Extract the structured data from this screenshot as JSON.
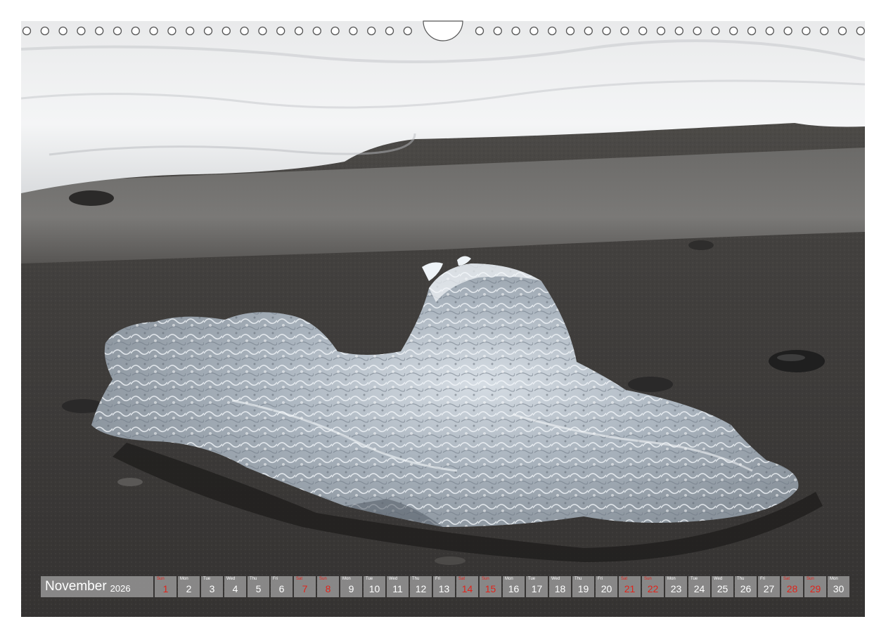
{
  "calendar": {
    "month": "November",
    "year": "2026",
    "weekend_color": "#e0241b",
    "days": [
      {
        "wd": "Sun",
        "n": "1",
        "red": true
      },
      {
        "wd": "Mon",
        "n": "2",
        "red": false
      },
      {
        "wd": "Tue",
        "n": "3",
        "red": false
      },
      {
        "wd": "Wed",
        "n": "4",
        "red": false
      },
      {
        "wd": "Thu",
        "n": "5",
        "red": false
      },
      {
        "wd": "Fri",
        "n": "6",
        "red": false
      },
      {
        "wd": "Sat",
        "n": "7",
        "red": true
      },
      {
        "wd": "Sun",
        "n": "8",
        "red": true
      },
      {
        "wd": "Mon",
        "n": "9",
        "red": false
      },
      {
        "wd": "Tue",
        "n": "10",
        "red": false
      },
      {
        "wd": "Wed",
        "n": "11",
        "red": false
      },
      {
        "wd": "Thu",
        "n": "12",
        "red": false
      },
      {
        "wd": "Fri",
        "n": "13",
        "red": false
      },
      {
        "wd": "Sat",
        "n": "14",
        "red": true
      },
      {
        "wd": "Sun",
        "n": "15",
        "red": true
      },
      {
        "wd": "Mon",
        "n": "16",
        "red": false
      },
      {
        "wd": "Tue",
        "n": "17",
        "red": false
      },
      {
        "wd": "Wed",
        "n": "18",
        "red": false
      },
      {
        "wd": "Thu",
        "n": "19",
        "red": false
      },
      {
        "wd": "Fri",
        "n": "20",
        "red": false
      },
      {
        "wd": "Sat",
        "n": "21",
        "red": true
      },
      {
        "wd": "Sun",
        "n": "22",
        "red": true
      },
      {
        "wd": "Mon",
        "n": "23",
        "red": false
      },
      {
        "wd": "Tue",
        "n": "24",
        "red": false
      },
      {
        "wd": "Wed",
        "n": "25",
        "red": false
      },
      {
        "wd": "Thu",
        "n": "26",
        "red": false
      },
      {
        "wd": "Fri",
        "n": "27",
        "red": false
      },
      {
        "wd": "Sat",
        "n": "28",
        "red": true
      },
      {
        "wd": "Sun",
        "n": "29",
        "red": true
      },
      {
        "wd": "Mon",
        "n": "30",
        "red": false
      }
    ]
  }
}
